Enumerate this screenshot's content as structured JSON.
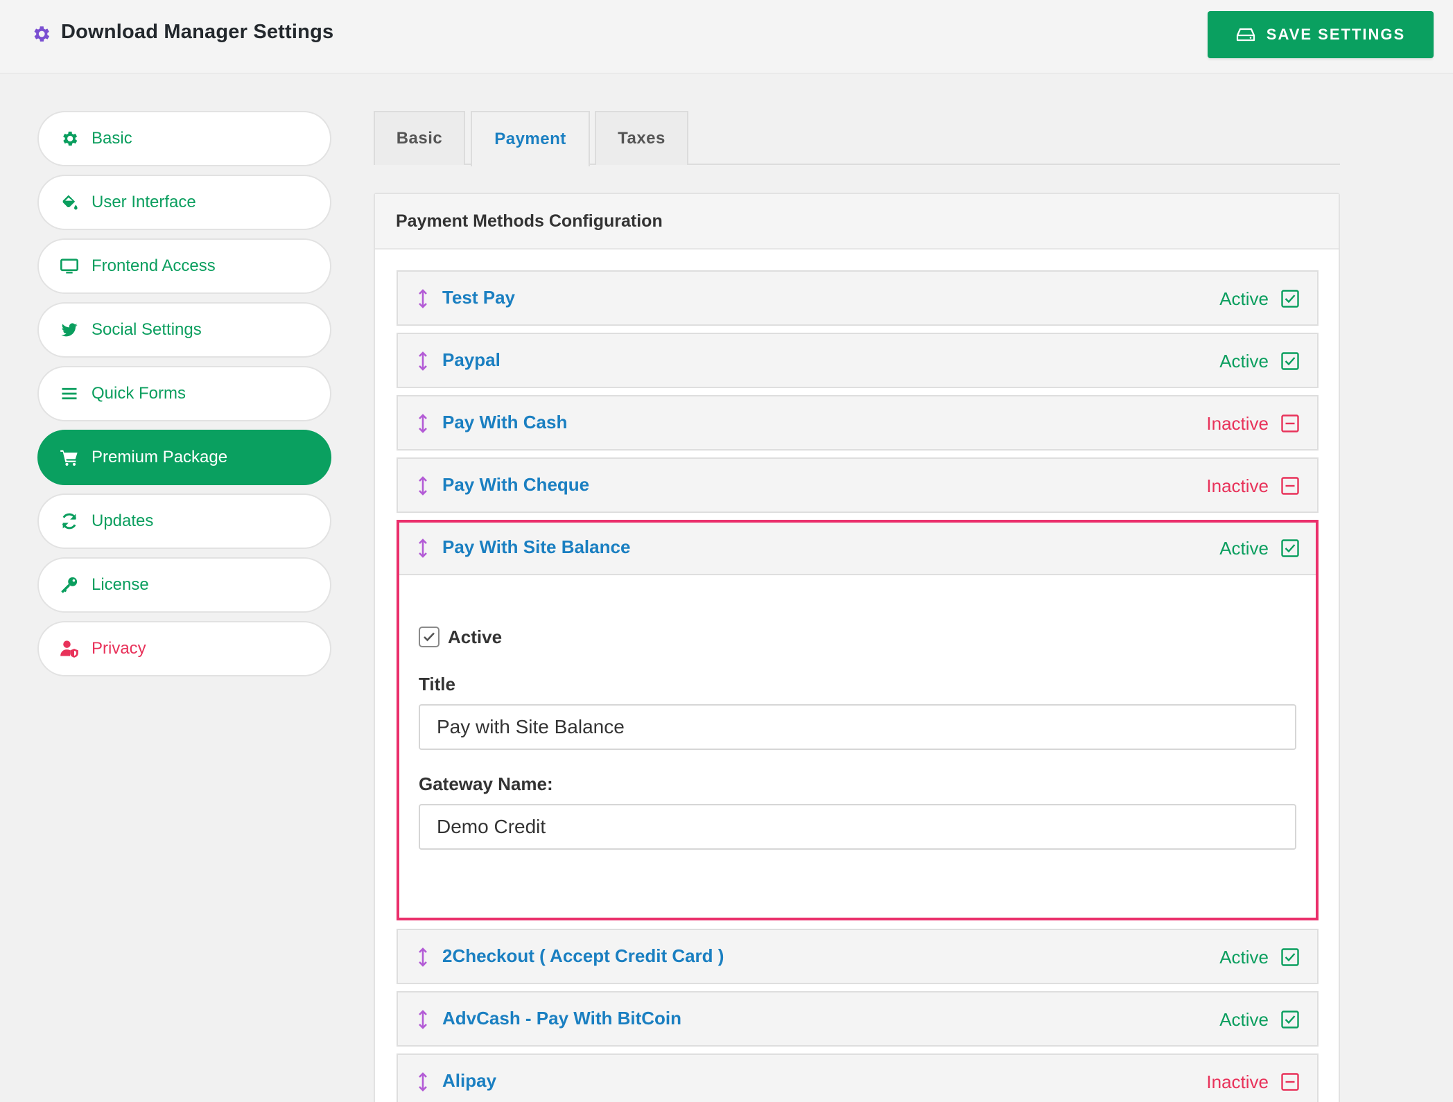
{
  "header": {
    "title": "Download Manager Settings",
    "save_label": "SAVE SETTINGS"
  },
  "sidebar": {
    "items": [
      {
        "label": "Basic",
        "icon": "gear-icon"
      },
      {
        "label": "User Interface",
        "icon": "paint-bucket-icon"
      },
      {
        "label": "Frontend Access",
        "icon": "monitor-icon"
      },
      {
        "label": "Social Settings",
        "icon": "twitter-icon"
      },
      {
        "label": "Quick Forms",
        "icon": "list-icon"
      },
      {
        "label": "Premium Package",
        "icon": "cart-icon",
        "active": true
      },
      {
        "label": "Updates",
        "icon": "refresh-icon"
      },
      {
        "label": "License",
        "icon": "key-icon"
      },
      {
        "label": "Privacy",
        "icon": "user-shield-icon"
      }
    ]
  },
  "tabs": [
    {
      "label": "Basic"
    },
    {
      "label": "Payment",
      "active": true
    },
    {
      "label": "Taxes"
    }
  ],
  "panel": {
    "title": "Payment Methods Configuration"
  },
  "methods": [
    {
      "name": "Test Pay",
      "status": "Active"
    },
    {
      "name": "Paypal",
      "status": "Active"
    },
    {
      "name": "Pay With Cash",
      "status": "Inactive"
    },
    {
      "name": "Pay With Cheque",
      "status": "Inactive"
    },
    {
      "name": "Pay With Site Balance",
      "status": "Active"
    },
    {
      "name": "2Checkout ( Accept Credit Card )",
      "status": "Active"
    },
    {
      "name": "AdvCash - Pay With BitCoin",
      "status": "Active"
    },
    {
      "name": "Alipay",
      "status": "Inactive"
    }
  ],
  "expanded_form": {
    "active_label": "Active",
    "active_checked": true,
    "title_label": "Title",
    "title_value": "Pay with Site Balance",
    "gateway_label": "Gateway Name:",
    "gateway_value": "Demo Credit"
  },
  "colors": {
    "accent_green": "#0aa060",
    "link_blue": "#1a7fc1",
    "inactive_red": "#e8325a",
    "highlight_pink": "#ea2f6b",
    "drag_purple": "#b35bd6",
    "gear_purple": "#7a4fd1"
  }
}
